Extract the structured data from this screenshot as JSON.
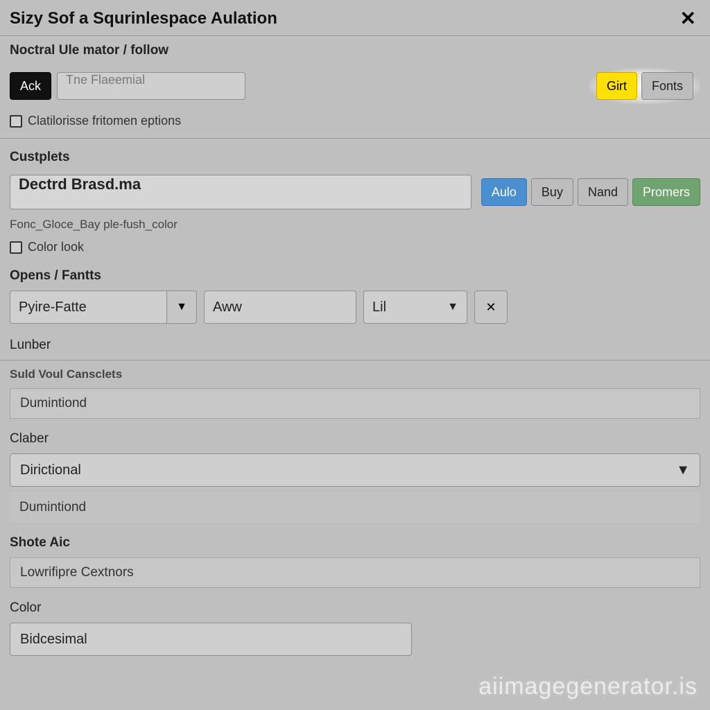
{
  "title": "Sizy Sof a Squrinlespace Aulation",
  "breadcrumb": "Noctral Ule mator / follow",
  "top": {
    "ack_label": "Ack",
    "input_placeholder": "Tne Flaeemial",
    "checkbox_label": "Clatilorisse fritomen eptions",
    "girt_label": "Girt",
    "fonts_label": "Fonts"
  },
  "custplets": {
    "label": "Custplets",
    "value": "Dectrd Brasd.ma",
    "sub_label": "Fonc_Gloce_Bay ple-fush_color",
    "colorlook_label": "Color look",
    "btn_auto": "Aulo",
    "btn_buy": "Buy",
    "btn_nand": "Nand",
    "btn_promers": "Promers"
  },
  "opens": {
    "label": "Opens / Fantts",
    "select1": "Pyire-Fatte",
    "select2": "Aww",
    "select3": "Lil"
  },
  "lunber": {
    "label": "Lunber",
    "sub_label": "Suld Voul Cansclets",
    "value": "Dumintiond"
  },
  "claber": {
    "label": "Claber",
    "select_value": "Dirictional",
    "readonly_value": "Dumintiond"
  },
  "shote": {
    "label": "Shote Aic",
    "value": "Lowrifipre Cextnors"
  },
  "color": {
    "label": "Color",
    "value": "Bidcesimal"
  },
  "watermark": "aiimagegenerator.is"
}
